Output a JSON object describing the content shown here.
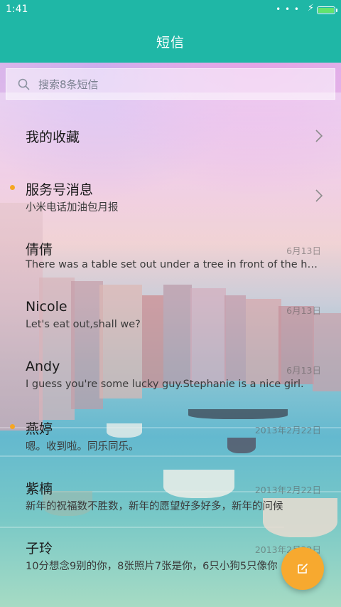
{
  "status_bar": {
    "time": "1:41",
    "signal_icon": "dots-icon",
    "charging_icon": "bolt-icon",
    "battery_level": 1.0
  },
  "title": "短信",
  "search": {
    "placeholder": "搜索8条短信",
    "icon": "search-icon"
  },
  "items": [
    {
      "name": "我的收藏",
      "type": "folder"
    },
    {
      "name": "服务号消息",
      "preview": "小米电话加油包月报",
      "unread": true,
      "type": "folder"
    },
    {
      "name": "倩倩",
      "preview": "There was a table set out under a tree in front of the house",
      "date": "6月13日"
    },
    {
      "name": "Nicole",
      "preview": "Let's eat out,shall we?",
      "date": "6月13日"
    },
    {
      "name": "Andy",
      "preview": "I guess you're some lucky guy.Stephanie is a nice girl.",
      "date": "6月13日"
    },
    {
      "name": "燕婷",
      "preview": "嗯。收到啦。同乐同乐。",
      "date": "2013年2月22日",
      "unread": true
    },
    {
      "name": "紫楠",
      "preview": "新年的祝福数不胜数，新年的愿望好多好多，新年的问候",
      "date": "2013年2月22日"
    },
    {
      "name": "子玲",
      "preview": "10分想念9别的你，8张照片7张是你，6只小狗5只像你",
      "date": "2013年2月22日"
    }
  ],
  "colors": {
    "accent": "#1fb7a6",
    "unread_dot": "#f5a623",
    "fab": "#f7a92f"
  },
  "fab": {
    "icon": "compose-icon"
  }
}
